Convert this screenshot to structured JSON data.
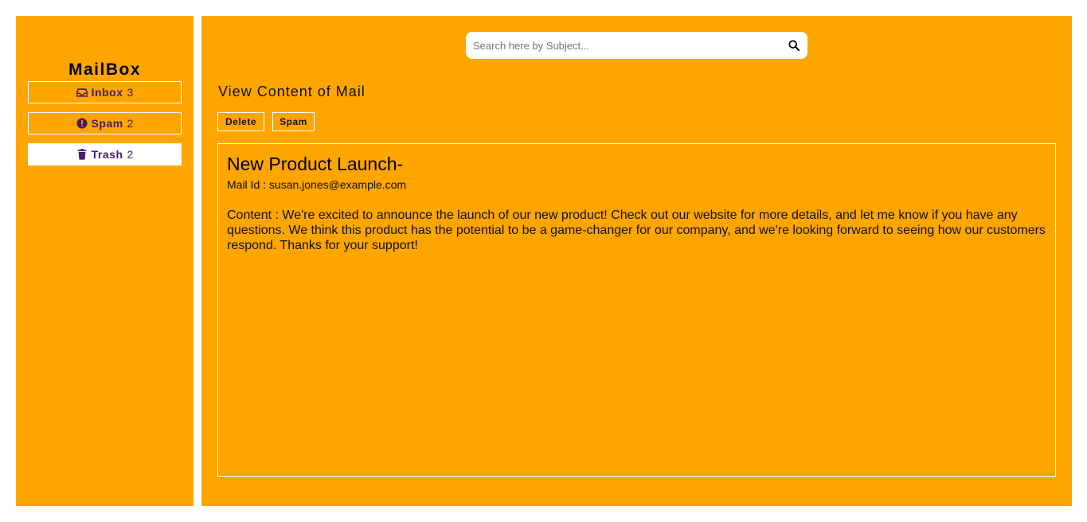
{
  "sidebar": {
    "brand": "MailBox",
    "items": [
      {
        "label": "Inbox",
        "count": "3",
        "icon": "inbox-icon",
        "active": false
      },
      {
        "label": "Spam",
        "count": "2",
        "icon": "alert-icon",
        "active": false
      },
      {
        "label": "Trash",
        "count": "2",
        "icon": "trash-icon",
        "active": true
      }
    ]
  },
  "search": {
    "placeholder": "Search here by Subject...",
    "value": "",
    "icon": "search-icon"
  },
  "main": {
    "section_title": "View Content of Mail",
    "buttons": {
      "delete": "Delete",
      "spam": "Spam"
    },
    "mail": {
      "subject": "New Product Launch-",
      "mail_id": "Mail Id : susan.jones@example.com",
      "content": "Content : We're excited to announce the launch of our new product! Check out our website for more details, and let me know if you have any questions. We think this product has the potential to be a game-changer for our company, and we're looking forward to seeing how our customers respond. Thanks for your support!"
    }
  },
  "colors": {
    "panel": "#FFA500",
    "accent_text": "#4B1A6E",
    "border": "#FFFFFF"
  }
}
